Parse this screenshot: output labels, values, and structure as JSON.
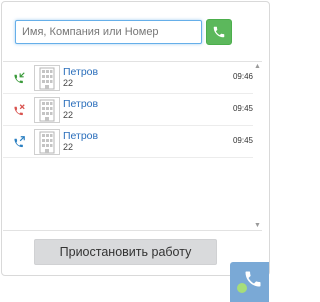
{
  "search": {
    "placeholder": "Имя, Компания или Номер"
  },
  "call_button": {
    "icon": "phone-icon"
  },
  "calls": [
    {
      "direction": "incoming",
      "direction_icon": "incoming-call-icon",
      "color": "#3a9a3a",
      "name": "Петров",
      "ext": "22",
      "time": "09:46"
    },
    {
      "direction": "missed",
      "direction_icon": "missed-call-icon",
      "color": "#d9534f",
      "name": "Петров",
      "ext": "22",
      "time": "09:45"
    },
    {
      "direction": "outgoing",
      "direction_icon": "outgoing-call-icon",
      "color": "#2a7fc1",
      "name": "Петров",
      "ext": "22",
      "time": "09:45"
    }
  ],
  "footer": {
    "pause_label": "Приостановить работу"
  },
  "widget": {
    "icon": "phone-icon",
    "status": "online",
    "status_color": "#a6dd7a"
  }
}
